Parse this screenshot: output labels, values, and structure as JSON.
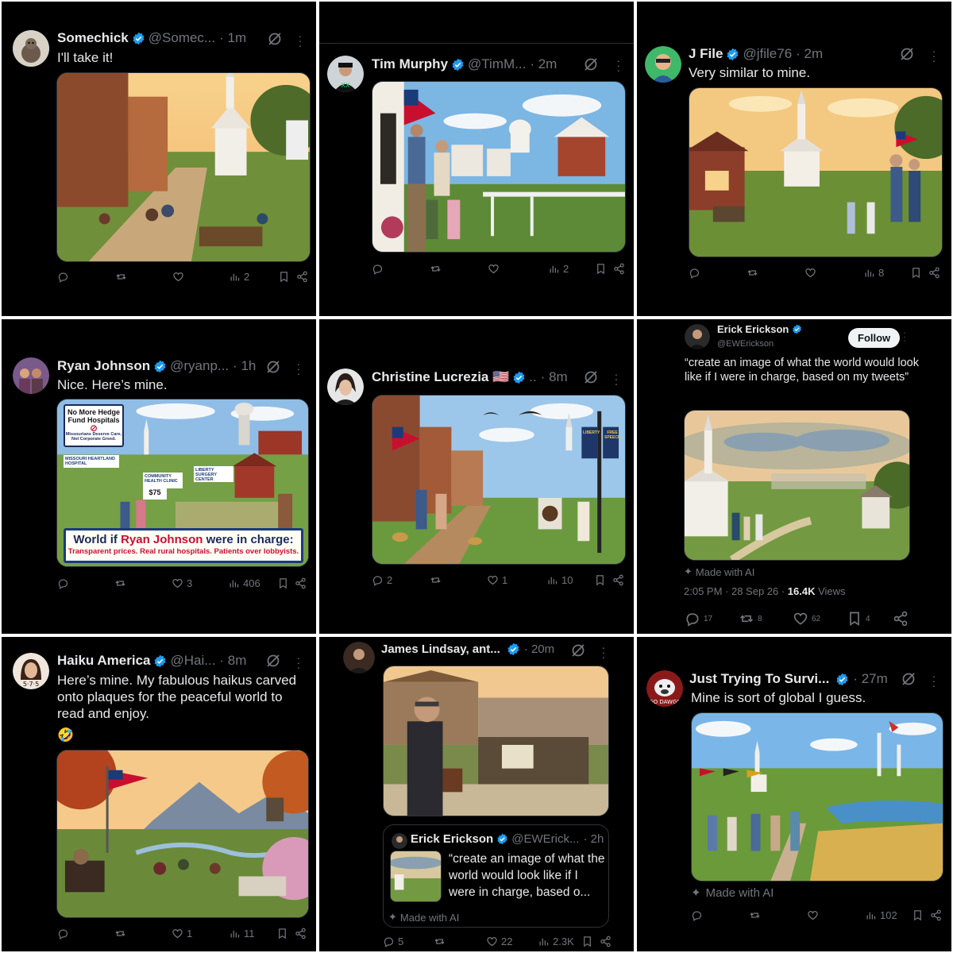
{
  "posts": [
    {
      "name": "Somechick",
      "handle": "@Somec...",
      "time": "· 1m",
      "text": "I'll take it!",
      "views": "2"
    },
    {
      "name": "Tim Murphy",
      "handle": "@TimM...",
      "time": "· 2m",
      "views": "2"
    },
    {
      "name": "J File",
      "handle": "@jfile76",
      "time": "· 2m",
      "text": "Very similar to mine.",
      "views": "8"
    },
    {
      "name": "Ryan Johnson",
      "handle": "@ryanp...",
      "time": "· 1h",
      "text": "Nice. Here’s mine.",
      "views": "406",
      "likes": "3",
      "image_texts": {
        "sign_title": "No More Hedge Fund Hospitals",
        "sign_sub": "Missourians Deserve Care, Not Corporate Greed.",
        "banner_a": "World if ",
        "banner_name": "Ryan Johnson",
        "banner_b": " were in charge:",
        "banner_sub": "Transparent prices. Real rural hospitals. Patients over lobbyists.",
        "clinic": "MISSOURI HEARTLAND HOSPITAL",
        "center": "COMMUNITY HEALTH CLINIC",
        "surgery": "LIBERTY SURGERY CENTER",
        "price": "$75"
      }
    },
    {
      "name": "Christine Lucrezia 🇺🇸",
      "handle": "..",
      "time": "· 8m",
      "replies": "2",
      "likes": "1",
      "views": "10",
      "image_texts": {
        "banner1": "LIBERTY",
        "banner2": "FREE SPEECH"
      }
    },
    {
      "name": "Erick Erickson",
      "handle": "@EWErickson",
      "follow": "Follow",
      "text": "“create an image of what the world would look like if I were in charge, based on my tweets”",
      "made_ai": "Made with AI",
      "stamp": "2:05 PM · 28 Sep 26 · ",
      "views_count": "16.4K",
      "views_word": " Views",
      "replies": "17",
      "reposts": "8",
      "likes": "62",
      "bookmarks": "4"
    },
    {
      "name": "Haiku America",
      "handle": "@Hai...",
      "time": "· 8m",
      "text": "Here’s mine. My fabulous haikus carved onto plaques for the peaceful world to read and enjoy.",
      "emoji": "🤣",
      "likes": "1",
      "views": "11"
    },
    {
      "name": "James Lindsay, ant...",
      "time": "· 20m",
      "quote": {
        "name": "Erick Erickson",
        "handle": "@EWErick...",
        "time": "· 2h",
        "text": "“create an image of what the world would look like if I were in charge, based o..."
      },
      "made_ai": "Made with AI",
      "replies": "5",
      "likes": "22",
      "views": "2.3K"
    },
    {
      "name": "Just Trying To Survi...",
      "time": "· 27m",
      "text": "Mine is sort of global I guess.",
      "made_ai": "Made with AI",
      "views": "102"
    }
  ],
  "icons": [
    "reply-icon",
    "repost-icon",
    "like-icon",
    "views-icon",
    "bookmark-icon",
    "share-icon",
    "verified-icon",
    "grok-icon",
    "more-icon",
    "sparkle-icon"
  ],
  "colors": {
    "background": "#000000",
    "text": "#e7e9ea",
    "secondary": "#71767b",
    "verified": "#1d9bf0",
    "border": "#2f3336"
  }
}
